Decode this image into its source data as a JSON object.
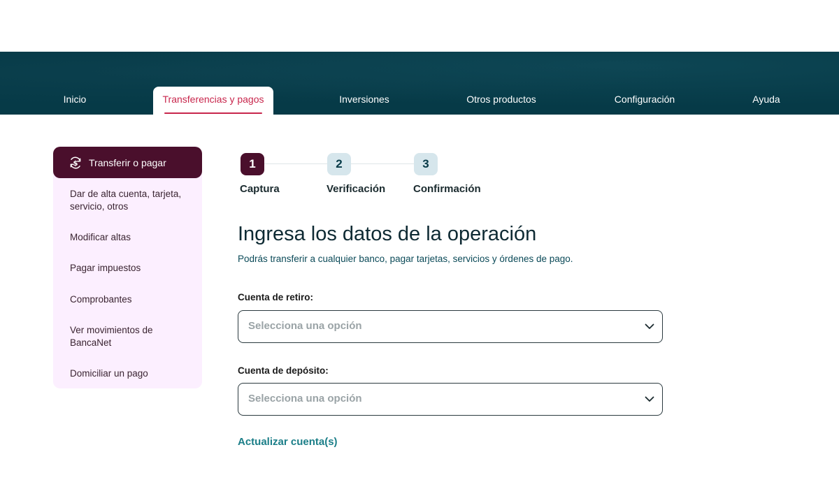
{
  "nav": {
    "items": [
      "Inicio",
      "Transferencias y pagos",
      "Inversiones",
      "Otros productos",
      "Configuración",
      "Ayuda"
    ]
  },
  "sidebar": {
    "header": "Transferir o pagar",
    "header_icon": "dollar-transfer-icon",
    "items": [
      "Dar de alta cuenta, tarjeta, servicio, otros",
      "Modificar altas",
      "Pagar impuestos",
      "Comprobantes",
      "Ver movimientos de BancaNet",
      "Domiciliar un pago"
    ]
  },
  "stepper": {
    "steps": [
      {
        "number": "1",
        "label": "Captura"
      },
      {
        "number": "2",
        "label": "Verificación"
      },
      {
        "number": "3",
        "label": "Confirmación"
      }
    ]
  },
  "form": {
    "title": "Ingresa los datos de la operación",
    "subtitle": "Podrás transferir a cualquier banco, pagar tarjetas, servicios y órdenes de pago.",
    "withdraw_label": "Cuenta de retiro:",
    "withdraw_placeholder": "Selecciona una opción",
    "deposit_label": "Cuenta de depósito:",
    "deposit_placeholder": "Selecciona una opción",
    "refresh_link": "Actualizar cuenta(s)"
  },
  "colors": {
    "nav_bg": "#063a47",
    "accent": "#c8264c",
    "sidebar_active": "#4a0f2c",
    "sidebar_bg": "#fcefff",
    "link": "#1b7e88"
  }
}
